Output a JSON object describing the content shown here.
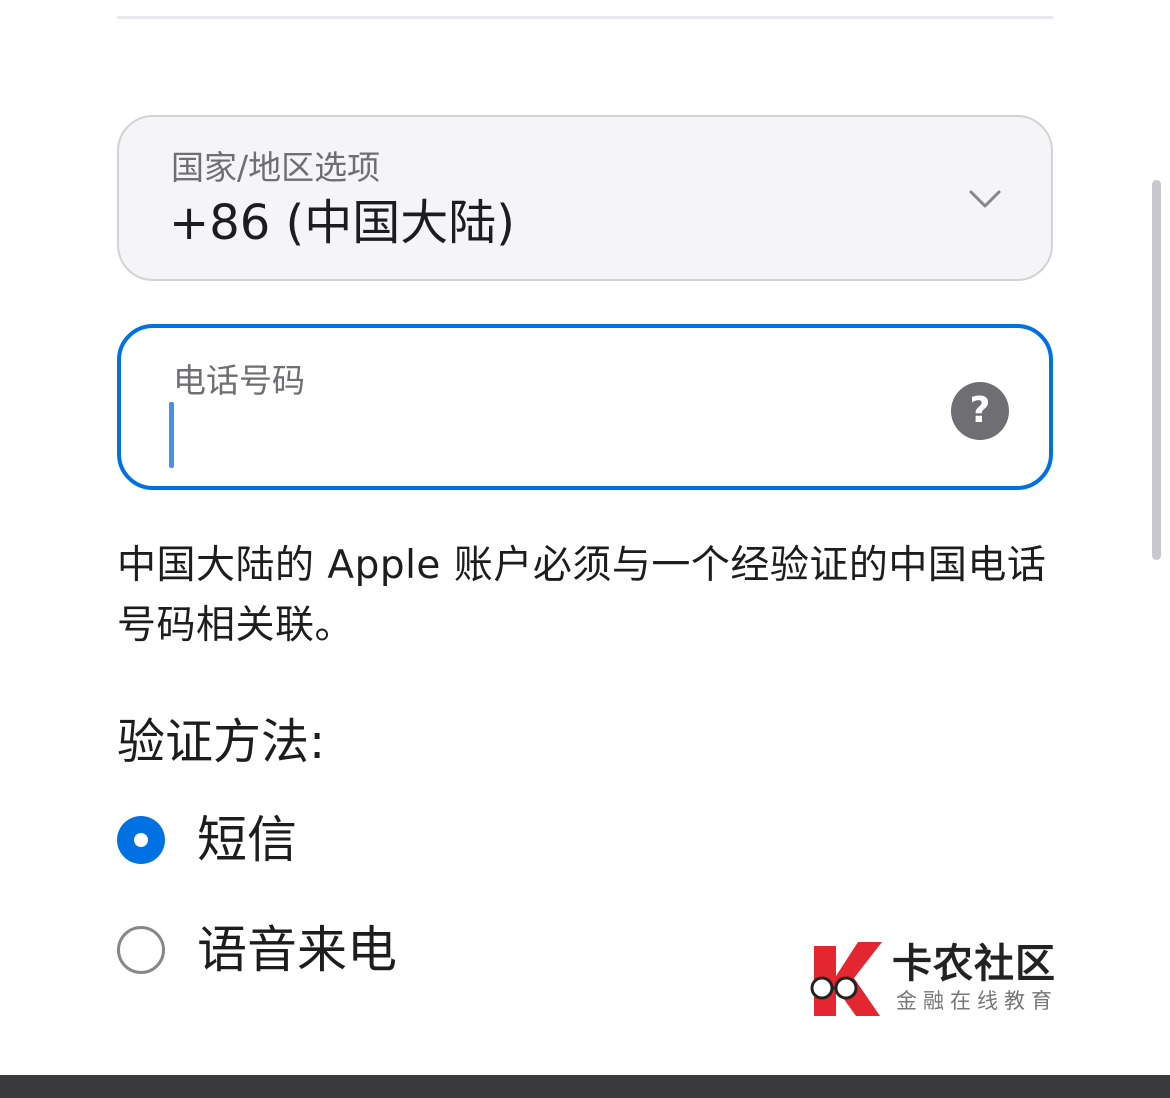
{
  "form": {
    "country": {
      "label": "国家/地区选项",
      "value": "+86 (中国大陆)"
    },
    "phone": {
      "label": "电话号码",
      "value": "",
      "help_label": "?"
    },
    "note": "中国大陆的 Apple 账户必须与一个经验证的中国电话号码相关联。",
    "verification": {
      "title": "验证方法:",
      "options": [
        {
          "label": "短信",
          "selected": true
        },
        {
          "label": "语音来电",
          "selected": false
        }
      ]
    }
  },
  "watermark": {
    "title": "卡农社区",
    "subtitle": "金融在线教育"
  },
  "colors": {
    "accent": "#0071e3",
    "field_background": "#f5f5f7",
    "help_button": "#6e6e73"
  },
  "icons": {
    "country_dropdown": "chevron-down-icon",
    "phone_help": "question-mark-icon"
  }
}
